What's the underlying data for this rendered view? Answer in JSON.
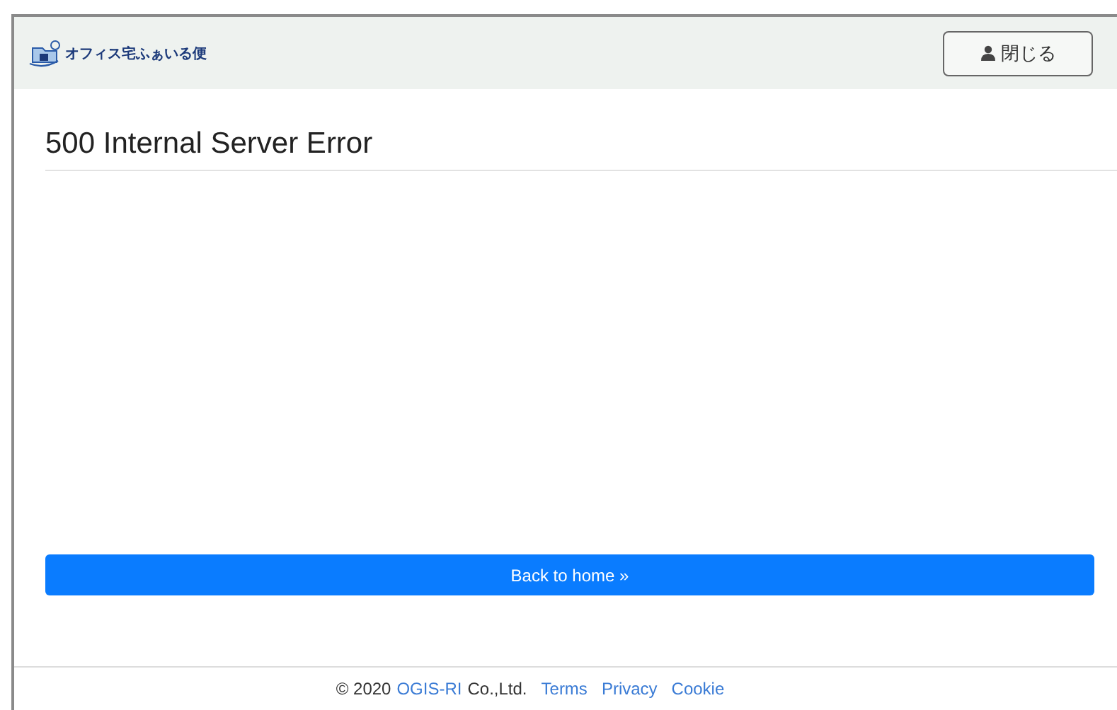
{
  "header": {
    "logo_text": "オフィス宅ふぁいる便",
    "close_button": "閉じる"
  },
  "title": "500 Internal Server Error",
  "back_button": "Back to home »",
  "footer": {
    "copyright": "© 2020",
    "company_link": "OGIS-RI",
    "company_suffix": "Co.,Ltd.",
    "links": [
      "Terms",
      "Privacy",
      "Cookie"
    ]
  }
}
